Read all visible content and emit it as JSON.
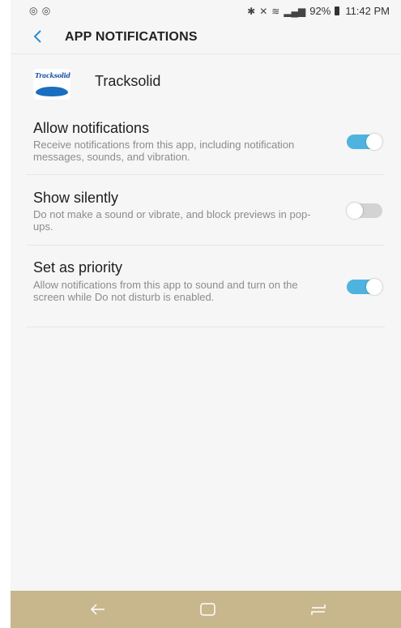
{
  "status_bar": {
    "left_icons": "◎ ◎",
    "battery_percent": "92%",
    "time": "11:42 PM"
  },
  "header": {
    "title": "APP NOTIFICATIONS"
  },
  "app": {
    "name": "Tracksolid",
    "logo_text": "Tracksolid"
  },
  "settings": [
    {
      "title": "Allow notifications",
      "description": "Receive notifications from this app, including notification messages, sounds, and vibration.",
      "enabled": true
    },
    {
      "title": "Show silently",
      "description": "Do not make a sound or vibrate, and block previews in pop-ups.",
      "enabled": false
    },
    {
      "title": "Set as priority",
      "description": "Allow notifications from this app to sound and turn on the screen while Do not disturb is enabled.",
      "enabled": true
    }
  ],
  "colors": {
    "toggle_on": "#4fb3df",
    "toggle_off": "#d3d3d3",
    "nav_bar": "#c8b78d",
    "accent_back": "#2a8fd0"
  }
}
